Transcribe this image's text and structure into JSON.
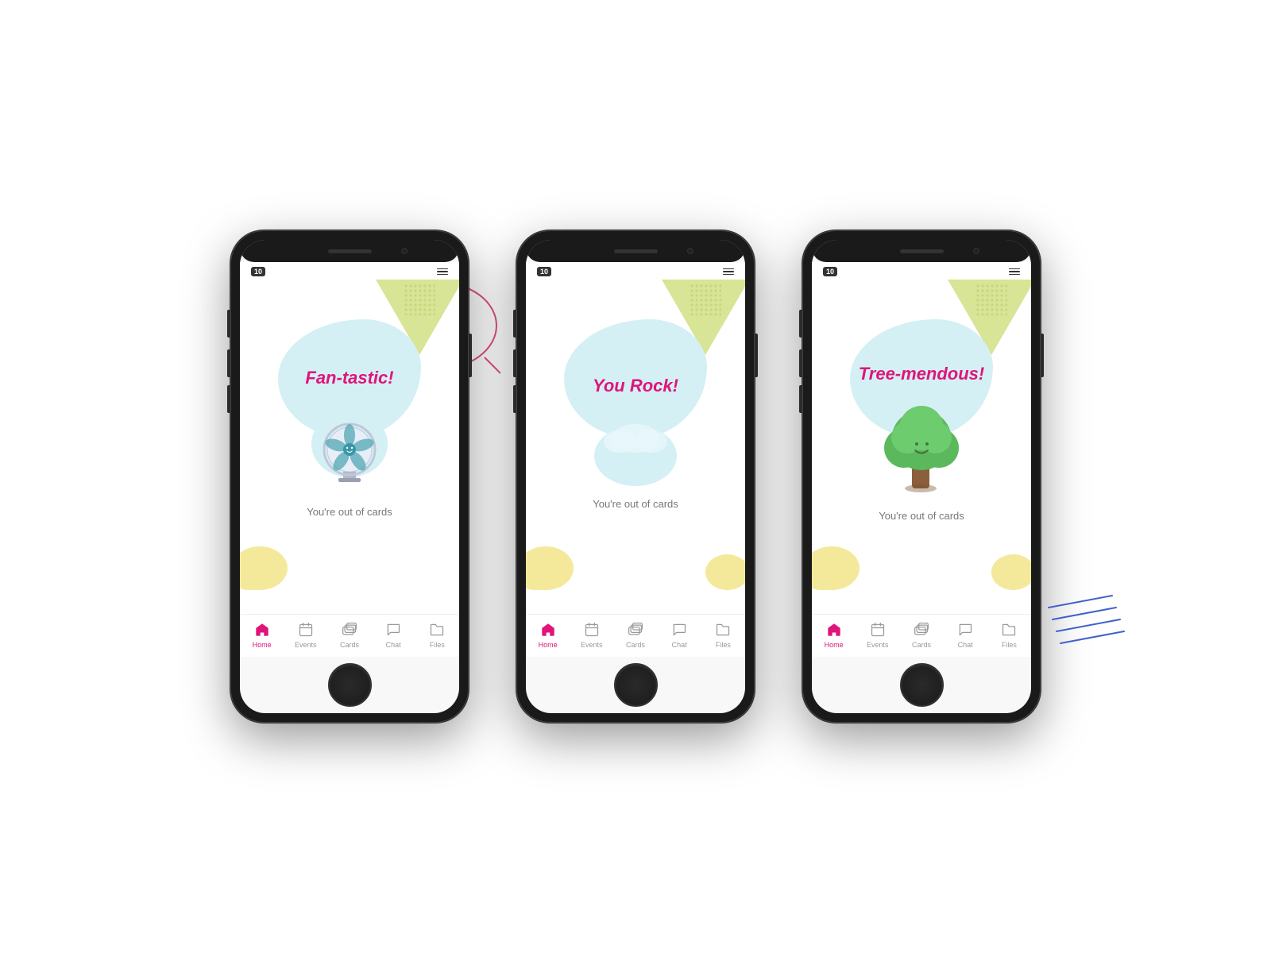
{
  "phones": [
    {
      "id": "phone1",
      "title": "Fan-tastic!",
      "subtitle": "You're out of cards",
      "illustration": "fan",
      "badge": "10"
    },
    {
      "id": "phone2",
      "title": "You Rock!",
      "subtitle": "You're out of cards",
      "illustration": "rock",
      "badge": "10"
    },
    {
      "id": "phone3",
      "title": "Tree-mendous!",
      "subtitle": "You're out of cards",
      "illustration": "tree",
      "badge": "10"
    }
  ],
  "nav": {
    "items": [
      {
        "label": "Home",
        "icon": "home-icon",
        "active": true
      },
      {
        "label": "Events",
        "icon": "events-icon",
        "active": false
      },
      {
        "label": "Cards",
        "icon": "cards-icon",
        "active": false
      },
      {
        "label": "Chat",
        "icon": "chat-icon",
        "active": false
      },
      {
        "label": "Files",
        "icon": "files-icon",
        "active": false
      }
    ]
  },
  "colors": {
    "accent": "#e0147a",
    "inactive": "#999999",
    "bg": "#ffffff"
  }
}
